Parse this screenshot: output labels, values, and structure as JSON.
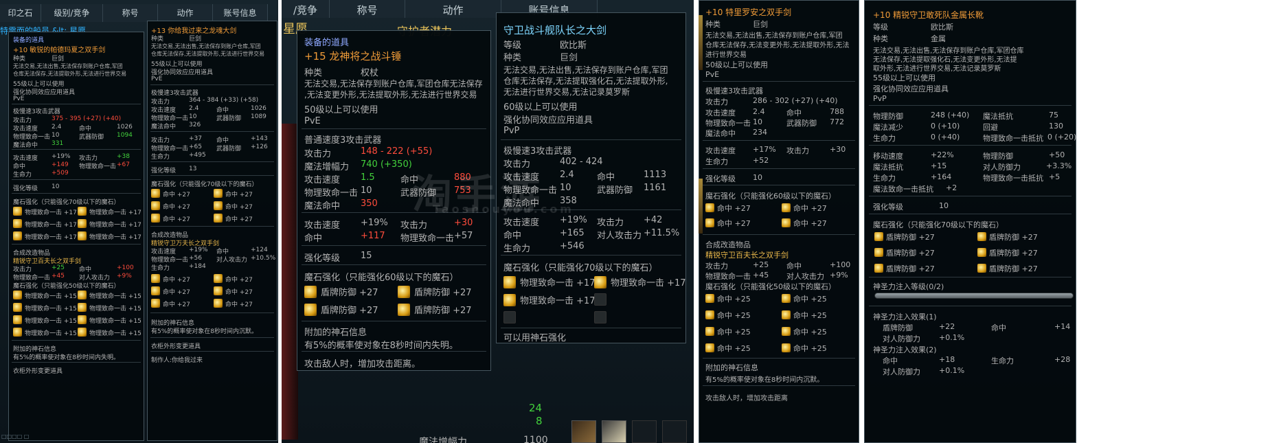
{
  "panel1": {
    "top_header": [
      "印之石",
      "级别/竞争",
      "称号",
      "动作",
      "账号信息"
    ],
    "behind_text": "特需而的船员 &lt; 星愿",
    "tip_a": {
      "equipped_label": "装备的道具",
      "title": "+10 敏锐的帕德玛夏之双手剑",
      "type_key": "种类",
      "type_val": "巨剑",
      "desc1": "无法交易,无法出售,无法保存到账户仓库,军团",
      "desc2": "仓库无法保存,无法提取外形,无法进行世界交易",
      "level_req": "55级以上可以使用",
      "enhance": "强化协同效应应用道具",
      "pve": "PvE",
      "weapon_type": "极慢速3攻击武器",
      "atk_k": "攻击力",
      "atk_v": "375 - 395 (+27) (+40)",
      "spd_k": "攻击速度",
      "spd_v": "2.4",
      "hit_k": "命中",
      "hit_v": "1026",
      "crit_k": "物理致命一击",
      "crit_v": "10",
      "parry_k": "武器防御",
      "parry_v": "1094",
      "mhit_k": "魔法命中",
      "mhit_v": "331",
      "b_spd_k": "攻击速度",
      "b_spd_v": "+19%",
      "b_atk_k": "攻击力",
      "b_atk_v": "+38",
      "b_hit_k": "命中",
      "b_hit_v": "+149",
      "b_crit_k": "物理致命一击",
      "b_crit_v": "+67",
      "b_hp_k": "生命力",
      "b_hp_v": "+509",
      "lvl_k": "强化等级",
      "lvl_v": "10",
      "mana_title": "魔石强化（只能强化70级以下的魔石）",
      "mana": [
        "物理致命一击 +17",
        "物理致命一击 +17",
        "物理致命一击 +17",
        "物理致命一击 +17",
        "物理致命一击 +17",
        "物理致命一击 +17"
      ],
      "fusion_title": "合成改造物品",
      "fusion_name": "精锐守卫百夫长之双手剑",
      "f_atk_k": "攻击力",
      "f_atk_v": "+25",
      "f_hit_k": "命中",
      "f_hit_v": "+100",
      "f_crit_k": "物理致命一击",
      "f_crit_v": "+45",
      "f_pvp_k": "对人攻击力",
      "f_pvp_v": "+9%",
      "f_mana_title": "魔石强化（只能强化50级以下的魔石）",
      "f_mana": [
        "物理致命一击 +15",
        "物理致命一击 +15",
        "物理致命一击 +15",
        "物理致命一击 +15",
        "物理致命一击 +15",
        "物理致命一击 +15",
        "物理致命一击 +15",
        "物理致命一击 +15"
      ],
      "god_title": "附加的神石信息",
      "god_desc": "有5%的概率使对象在8秒时间内失明。",
      "skin": "衣柜外形变更道具"
    },
    "tip_b": {
      "title": "+13 你给我过来之龙魂大剑",
      "type_k": "种类",
      "type_v": "巨剑",
      "desc1": "无法交易,无法出售,无法保存到账户仓库,军团",
      "desc2": "仓库无法保存,无法提取外形,无法进行世界交易",
      "level_req": "55级以上可以使用",
      "enhance": "强化协同效应应用道具",
      "pve": "PvE",
      "weapon_type": "极慢速3攻击武器",
      "atk_k": "攻击力",
      "atk_v": "364 - 384 (+33) (+58)",
      "spd_k": "攻击速度",
      "spd_v": "2.4",
      "hit_k": "命中",
      "hit_v": "1026",
      "crit_k": "物理致命一击",
      "crit_v": "10",
      "parry_k": "武器防御",
      "parry_v": "1089",
      "mhit_k": "魔法命中",
      "mhit_v": "326",
      "b_atk_k": "攻击力",
      "b_atk_v": "+37",
      "b_hit_k": "命中",
      "b_hit_v": "+143",
      "b_crit_k": "物理致命一击",
      "b_crit_v": "+65",
      "b_parry_k": "武器防御",
      "b_parry_v": "+126",
      "b_hp_k": "生命力",
      "b_hp_v": "+495",
      "lvl_k": "强化等级",
      "lvl_v": "13",
      "mana_title": "魔石强化（只能强化70级以下的魔石）",
      "mana": [
        "命中 +27",
        "命中 +27",
        "命中 +27",
        "命中 +27",
        "命中 +27",
        "命中 +27"
      ],
      "fusion_title": "合成改造物品",
      "fusion_name": "精锐守卫万夫长之双手剑",
      "f_spd_k": "攻击速度",
      "f_spd_v": "+19%",
      "f_hit_k": "命中",
      "f_hit_v": "+124",
      "f_crit_k": "物理致命一击",
      "f_crit_v": "+56",
      "f_pvp_k": "对人攻击力",
      "f_pvp_v": "+10.5%",
      "f_hp_k": "生命力",
      "f_hp_v": "+184",
      "f_mana": [
        "命中 +27",
        "命中 +27",
        "命中 +27",
        "命中 +27",
        "命中 +27",
        "命中 +27"
      ],
      "god_title": "附加的神石信息",
      "god_desc": "有5%的概率使对象在8秒时间内沉默。",
      "skin": "衣柜外形变更道具",
      "maker": "制作人:你给我过来"
    },
    "bottom": "□□□□ □"
  },
  "panel2": {
    "top_header": [
      "/竞争",
      "称号",
      "动作",
      "账号信息"
    ],
    "behind_star": "星愿",
    "behind_mid": "守护者潜力",
    "behind_nums": [
      "24",
      "8"
    ],
    "behind_bottom": "魔法增幅力",
    "behind_bottom_val": "1100",
    "watermark": "淘手游",
    "watermark_sub": "Taoshouyou.com",
    "tip_a": {
      "equipped_label": "装备的道具",
      "title": "+15 龙神将之战斗锤",
      "type_k": "种类",
      "type_v": "权杖",
      "desc1": "无法交易,无法保存到账户仓库,军团仓库无法保存",
      "desc2": ",无法变更外形,无法提取外形,无法进行世界交易",
      "level_req": "50级以上可以使用",
      "pve": "PvE",
      "weapon_type": "普通速度3攻击武器",
      "atk_k": "攻击力",
      "atk_v": "148 - 222 (+55)",
      "mag_k": "魔法增幅力",
      "mag_v": "740 (+350)",
      "spd_k": "攻击速度",
      "spd_v": "1.5",
      "hit_k": "命中",
      "hit_v": "880",
      "crit_k": "物理致命一击",
      "crit_v": "10",
      "parry_k": "武器防御",
      "parry_v": "753",
      "mhit_k": "魔法命中",
      "mhit_v": "350",
      "b_spd_k": "攻击速度",
      "b_spd_v": "+19%",
      "b_atk_k": "攻击力",
      "b_atk_v": "+30",
      "b_hit_k": "命中",
      "b_hit_v": "+117",
      "b_crit_k": "物理致命一击",
      "b_crit_v": "+57",
      "lvl_k": "强化等级",
      "lvl_v": "15",
      "mana_title": "魔石强化（只能强化60级以下的魔石）",
      "mana": [
        "盾牌防御 +27",
        "盾牌防御 +27",
        "盾牌防御 +27",
        "盾牌防御 +27"
      ],
      "god_title": "附加的神石信息",
      "god_desc": "有5%的概率使对象在8秒时间内失明。",
      "skill": "攻击敌人时，增加攻击距离。"
    },
    "tip_b": {
      "title": "守卫战斗舰队长之大剑",
      "lvl_k": "等级",
      "lvl_v": "欧比斯",
      "type_k": "种类",
      "type_v": "巨剑",
      "desc1": "无法交易,无法出售,无法保存到账户仓库,军团",
      "desc2": "仓库无法保存,无法提取强化石,无法提取外形,",
      "desc3": "无法进行世界交易,无法记录莫罗斯",
      "level_req": "60级以上可以使用",
      "enhance": "强化协同效应应用道具",
      "pvp": "PvP",
      "weapon_type": "极慢速3攻击武器",
      "atk_k": "攻击力",
      "atk_v": "402 - 424",
      "spd_k": "攻击速度",
      "spd_v": "2.4",
      "hit_k": "命中",
      "hit_v": "1113",
      "crit_k": "物理致命一击",
      "crit_v": "10",
      "parry_k": "武器防御",
      "parry_v": "1161",
      "mhit_k": "魔法命中",
      "mhit_v": "358",
      "b_spd_k": "攻击速度",
      "b_spd_v": "+19%",
      "b_atk_k": "攻击力",
      "b_atk_v": "+42",
      "b_hit_k": "命中",
      "b_hit_v": "+165",
      "b_pvp_k": "对人攻击力",
      "b_pvp_v": "+11.5%",
      "b_hp_k": "生命力",
      "b_hp_v": "+546",
      "mana_title": "魔石强化（只能强化70级以下的魔石）",
      "mana": [
        "物理致命一击 +17",
        "物理致命一击 +17",
        "物理致命一击 +17"
      ],
      "godstone": "可以用神石强化"
    }
  },
  "panel3": {
    "title": "+10 特里罗安之双手剑",
    "type_k": "种类",
    "type_v": "巨剑",
    "desc1": "无法交易,无法出售,无法保存到账户仓库,军团",
    "desc2": "仓库无法保存,无法变更外形,无法提取外形,无法",
    "desc3": "进行世界交易",
    "level_req": "50级以上可以使用",
    "pve": "PvE",
    "weapon_type": "极慢速3攻击武器",
    "atk_k": "攻击力",
    "atk_v": "286 - 302 (+27) (+40)",
    "spd_k": "攻击速度",
    "spd_v": "2.4",
    "hit_k": "命中",
    "hit_v": "788",
    "crit_k": "物理致命一击",
    "crit_v": "10",
    "parry_k": "武器防御",
    "parry_v": "772",
    "mhit_k": "魔法命中",
    "mhit_v": "234",
    "b_spd_k": "攻击速度",
    "b_spd_v": "+17%",
    "b_atk_k": "攻击力",
    "b_atk_v": "+30",
    "b_hp_k": "生命力",
    "b_hp_v": "+52",
    "lvl_k": "强化等级",
    "lvl_v": "10",
    "mana_title": "魔石强化（只能强化60级以下的魔石）",
    "mana": [
      "命中 +27",
      "命中 +27",
      "命中 +27",
      "命中 +27",
      "命中 +27",
      "命中 +27"
    ],
    "fusion_title": "合成改造物品",
    "fusion_name": "精锐守卫百夫长之双手剑",
    "f_atk_k": "攻击力",
    "f_atk_v": "+25",
    "f_hit_k": "命中",
    "f_hit_v": "+100",
    "f_crit_k": "物理致命一击",
    "f_crit_v": "+45",
    "f_pvp_k": "对人攻击力",
    "f_pvp_v": "+9%",
    "f_mana_title": "魔石强化（只能强化50级以下的魔石）",
    "f_mana": [
      "命中 +25",
      "命中 +25",
      "命中 +25",
      "命中 +25",
      "命中 +25",
      "命中 +25",
      "命中 +25",
      "命中 +25"
    ],
    "god_title": "附加的神石信息",
    "god_desc": "有5%的概率使对象在8秒时间内沉默。",
    "cut": "攻击敌人时，增加攻击距离"
  },
  "panel4": {
    "title": "+10 精锐守卫敢死队金属长靴",
    "lvl_k": "等级",
    "lvl_v": "欧比斯",
    "type_k": "种类",
    "type_v": "金属",
    "desc1": "无法交易,无法出售,无法保存到账户仓库,军团仓库",
    "desc2": "无法保存,无法提取强化石,无法变更外形,无法提",
    "desc3": "取外形,无法进行世界交易,无法记录莫罗斯",
    "level_req": "55级以上可以使用",
    "enhance": "强化协同效应应用道具",
    "pvp": "PvP",
    "def_k": "物理防御",
    "def_v": "248 (+40)",
    "mres_k": "魔法抵抗",
    "mres_v": "75",
    "mred_k": "魔法减少",
    "mred_v": "0 (+10)",
    "eva_k": "回避",
    "eva_v": "130",
    "hp_k": "生命力",
    "hp_v": "0 (+40)",
    "cres_k": "物理致命一击抵抗",
    "cres_v": "0 (+20)",
    "ms_k": "移动速度",
    "ms_v": "+22%",
    "bdef_k": "物理防御",
    "bdef_v": "+50",
    "bmres_k": "魔法抵抗",
    "bmres_v": "+15",
    "bpvp_k": "对人防御力",
    "bpvp_v": "+3.3%",
    "bhp_k": "生命力",
    "bhp_v": "+164",
    "bcres_k": "物理致命一击抵抗",
    "bcres_v": "+5",
    "bmcres_k": "魔法致命一击抵抗",
    "bmcres_v": "+2",
    "slvl_k": "强化等级",
    "slvl_v": "10",
    "mana_title": "魔石强化（只能强化70级以下的魔石）",
    "mana": [
      "盾牌防御 +27",
      "盾牌防御 +27",
      "盾牌防御 +27",
      "盾牌防御 +27",
      "盾牌防御 +27",
      "盾牌防御 +27"
    ],
    "holy_title": "神圣力注入等级(0/2)",
    "holy_progress": 0,
    "e1_title": "神圣力注入效果(1)",
    "e1_a_k": "盾牌防御",
    "e1_a_v": "+22",
    "e1_b_k": "命中",
    "e1_b_v": "+14",
    "e1_c_k": "对人防御力",
    "e1_c_v": "+0.1%",
    "e2_title": "神圣力注入效果(2)",
    "e2_a_k": "命中",
    "e2_a_v": "+18",
    "e2_b_k": "生命力",
    "e2_b_v": "+28",
    "e2_c_k": "对人防御力",
    "e2_c_v": "+0.1%"
  }
}
